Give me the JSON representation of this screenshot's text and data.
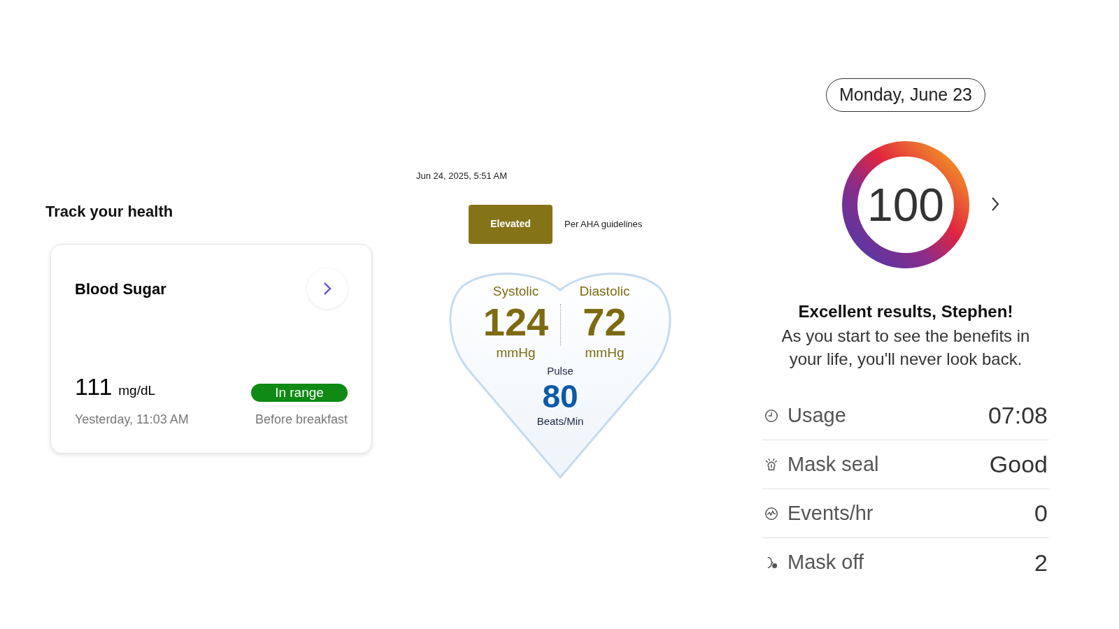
{
  "health": {
    "title": "Track your health",
    "card": {
      "title": "Blood Sugar",
      "value": "111",
      "unit": "mg/dL",
      "status": "In range",
      "time": "Yesterday, 11:03 AM",
      "context": "Before breakfast"
    }
  },
  "blood_pressure": {
    "timestamp": "Jun 24, 2025, 5:51 AM",
    "category": "Elevated",
    "note": "Per AHA guidelines",
    "systolic": {
      "label": "Systolic",
      "value": "124",
      "unit": "mmHg"
    },
    "diastolic": {
      "label": "Diastolic",
      "value": "72",
      "unit": "mmHg"
    },
    "pulse": {
      "label": "Pulse",
      "value": "80",
      "unit": "Beats/Min"
    }
  },
  "sleep": {
    "date": "Monday, June 23",
    "score": "100",
    "level": 1,
    "headline": "Excellent results, Stephen!",
    "message": "As you start to see the benefits in your life, you'll never look back.",
    "rows": [
      {
        "kind": "clock",
        "label": "Usage",
        "value": "07:08"
      },
      {
        "kind": "mask",
        "label": "Mask seal",
        "value": "Good"
      },
      {
        "kind": "events",
        "label": "Events/hr",
        "value": "0"
      },
      {
        "kind": "maskoff",
        "label": "Mask off",
        "value": "2"
      }
    ]
  }
}
